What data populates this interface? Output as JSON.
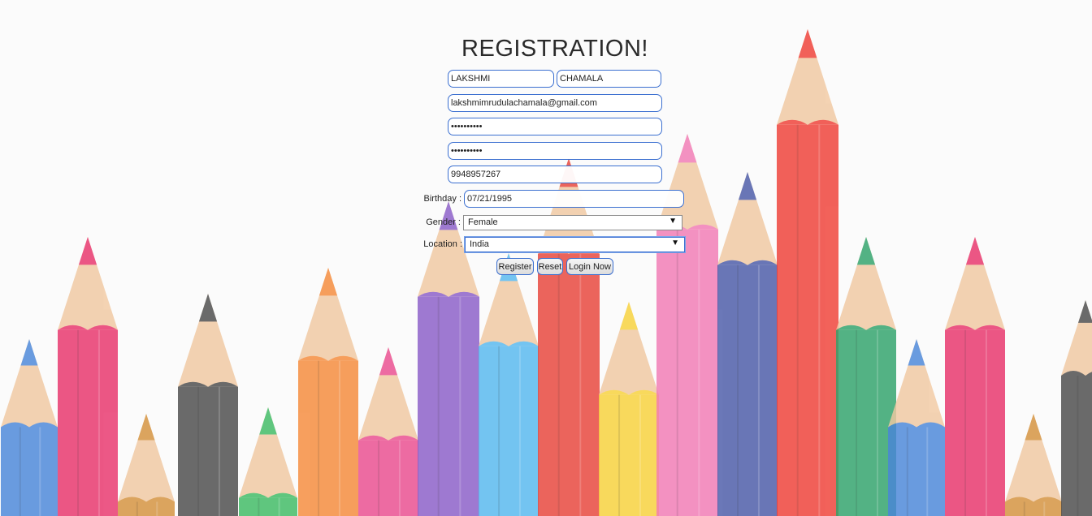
{
  "form": {
    "title": "REGISTRATION!",
    "first_name": "LAKSHMI",
    "last_name": "CHAMALA",
    "email": "lakshmimrudulachamala@gmail.com",
    "password": "••••••••••",
    "confirm_password": "••••••••••",
    "phone": "9948957267",
    "birthday_label": "Birthday :",
    "birthday": "07/21/1995",
    "gender_label": "Gender :",
    "gender": "Female",
    "location_label": "Location :",
    "location": "India",
    "register_label": "Register",
    "reset_label": "Reset",
    "login_label": "Login Now"
  },
  "background": {
    "pencil_colors": [
      "#4a86d9",
      "#e8336b",
      "#d4913c",
      "#4b4b4b",
      "#3dbb63",
      "#f58a3a",
      "#ea4c8f",
      "#8a5dc8",
      "#56b8ef",
      "#e8433a",
      "#f8d23a",
      "#f27ab5",
      "#4a5aa8",
      "#ef3f36",
      "#2fa36a",
      "#4a86d9",
      "#e8336b",
      "#d4913c",
      "#4b4b4b"
    ]
  }
}
